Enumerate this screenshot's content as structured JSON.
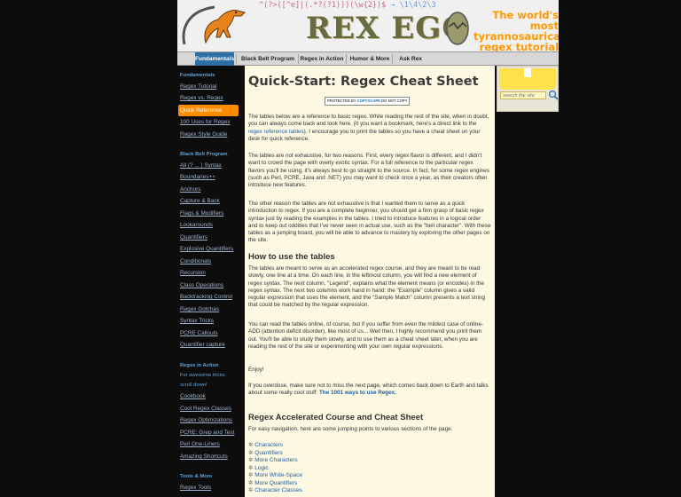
{
  "header": {
    "regex_strip": [
      "^(?>([^e]|(.*?(?1)))(\\w{2})$",
      "→ \\1\\4\\2\\3"
    ],
    "regex_colors": [
      "#d46a6a",
      "#e0a030",
      "#7fc07f",
      "#6a9adf",
      "#c07fd0"
    ],
    "logo_title": "REX EGG",
    "tagline": [
      "The world's most",
      "tyrannosaurical",
      "regex tutorial"
    ],
    "accent_color": "#ff9900"
  },
  "nav": {
    "tabs": [
      "Fundamentals",
      "Black Belt Program",
      "Regex in Action",
      "Humor & More",
      "Ask Rex"
    ],
    "active_tab": 0
  },
  "sidebar": {
    "sections": [
      {
        "title": "Fundamentals",
        "items": [
          "Regex Tutorial",
          "Regex vs. Regex",
          "Quick Reference",
          "100 Uses for Regex",
          "Regex Style Guide"
        ],
        "active_item": 2
      },
      {
        "title": "Black Belt Program",
        "items": [
          "All (? ... ) Syntax",
          "Boundaries++",
          "Anchors",
          "Capture & Back",
          "Flags & Modifiers",
          "Lookarounds",
          "Quantifiers",
          "Explosive Quantifiers",
          "Conditionals",
          "Recursion",
          "Class Operations",
          "Backtracking Control",
          "Regex Gotchas",
          "Syntax Tricks",
          "PCRE Callouts",
          "Quantifier capture"
        ]
      },
      {
        "title": "Regex in Action",
        "note": [
          "For awesome tricks:",
          "scroll down!"
        ],
        "items": [
          "Cookbook",
          "Cool Regex Classes",
          "Regex Optimizations",
          "PCRE: Grep and Test",
          "Perl One-Liners",
          "Amazing Shortcuts"
        ]
      },
      {
        "title": "Tools & More",
        "items": [
          "Regex Tools"
        ]
      }
    ]
  },
  "main": {
    "title": "Quick-Start: Regex Cheat Sheet",
    "copyscape": {
      "prefix": "PROTECTED BY",
      "brand": "COPYSCAPE",
      "suffix": "DO NOT COPY"
    },
    "intro": {
      "before_link": "The tables below are a reference to basic regex. While reading the rest of the site, when in doubt, you can always come back and look here. (It you want a bookmark, here's a direct link to the ",
      "link": "regex reference tables",
      "after_link": "). I encourage you to print the tables so you have a cheat sheet on your desk for quick reference."
    },
    "para2": "The tables are not exhaustive, for two reasons. First, every regex flavor is different, and I didn't want to crowd the page with overly exotic syntax. For a full reference to the particular regex flavors you'll be using, it's always best to go straight to the source. In fact, for some regex engines (such as Perl, PCRE, Java and .NET) you may want to check once a year, as their creators often introduce new features.",
    "para3": "The other reason the tables are not exhaustive is that I wanted them to serve as a quick introduction to regex. If you are a complete beginner, you should get a firm grasp of basic regex syntax just by reading the examples in the tables. I tried to introduce features in a logical order and to keep out oddities that I've never seen in actual use, such as the \"bell character\". With these tables as a jumping board, you will be able to advance to mastery by exploring the other pages on the site.",
    "section1_title": "How to use the tables",
    "para4": "The tables are meant to serve as an accelerated regex course, and they are meant to be read slowly, one line at a time. On each line, in the leftmost column, you will find a new element of regex syntax. The next column, \"Legend\", explains what the element means (or encodes) in the regex syntax. The next two columns work hand in hand: the \"Example\" column gives a valid regular expression that uses the element, and the \"Sample Match\" column presents a text string that could be matched by the regular expression.",
    "para5": "You can read the tables online, of course, but if you suffer from even the mildest case of online-ADD (attention deficit disorder), like most of us... Well then, I highly recommend you print them out. You'll be able to study them slowly, and to use them as a cheat sheet later, when you are reading the rest of the site or experimenting with your own regular expressions.",
    "enjoy": "Enjoy!",
    "overdose": {
      "before_link": "If you overdose, make sure not to miss the next page, which comes back down to Earth and talks about some really cool stuff: ",
      "link": "The 1001 ways to use Regex."
    },
    "section2_title": "Regex Accelerated Course and Cheat Sheet",
    "toc_intro": "For easy navigation, here are some jumping points to various sections of the page:",
    "toc_bullet": "✲",
    "toc": [
      "Characters",
      "Quantifiers",
      "More Characters",
      "Logic",
      "More White-Space",
      "More Quantifiers",
      "Character Classes"
    ]
  },
  "right": {
    "search_placeholder": "search the site"
  }
}
